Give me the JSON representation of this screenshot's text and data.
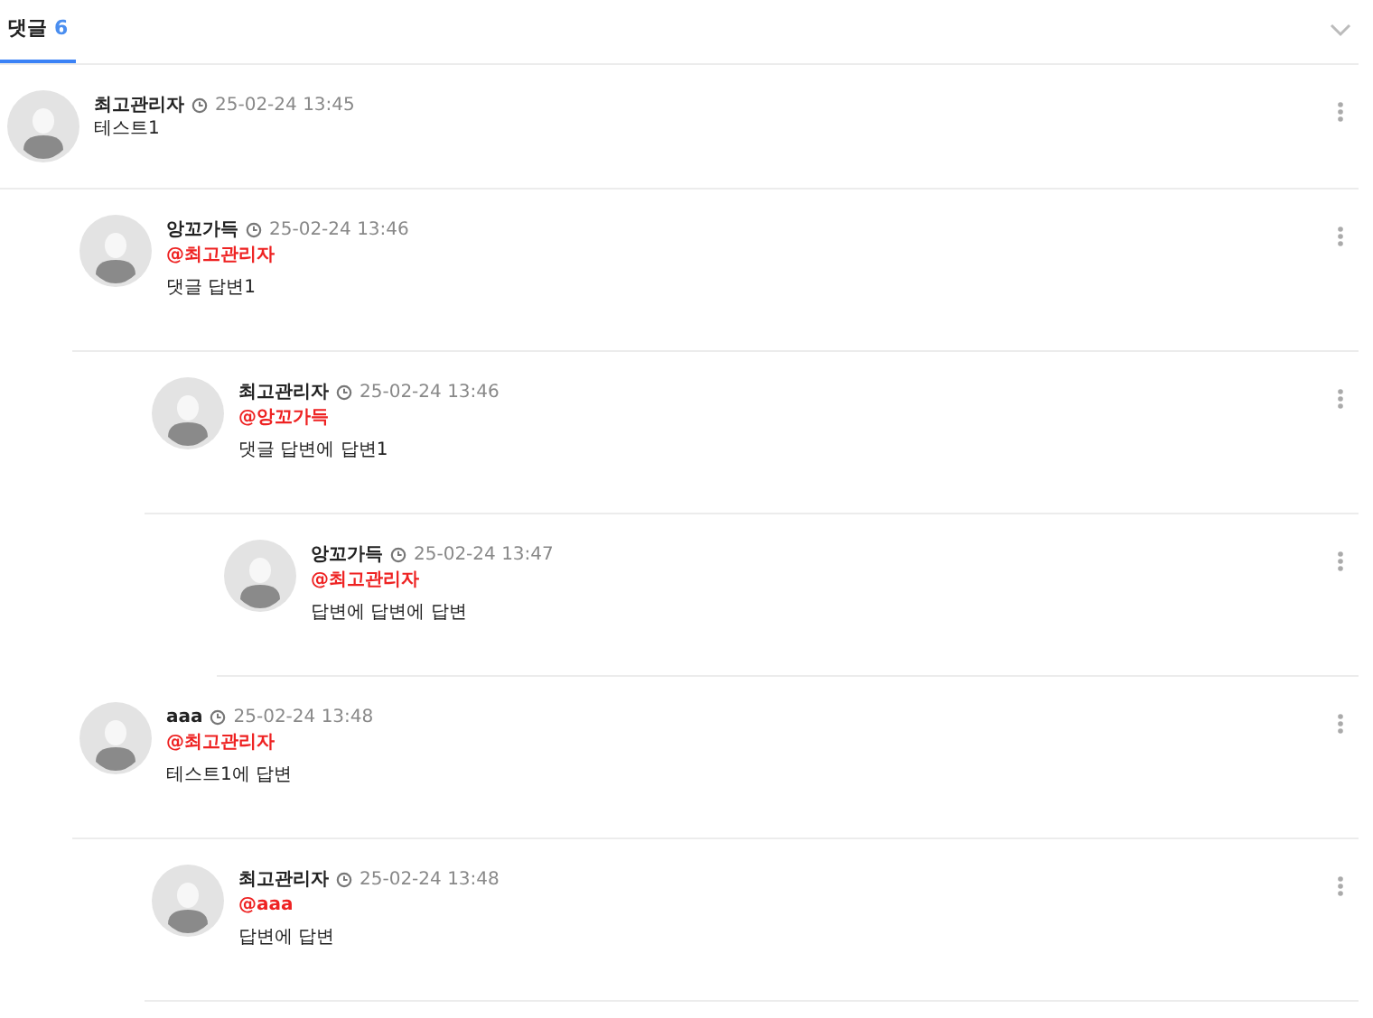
{
  "header": {
    "title": "댓글",
    "count": "6"
  },
  "comments": [
    {
      "author": "최고관리자",
      "time": "25-02-24 13:45",
      "text": "테스트1",
      "children": [
        {
          "author": "앙꼬가득",
          "time": "25-02-24 13:46",
          "mention": "@최고관리자",
          "text": "댓글 답변1",
          "children": [
            {
              "author": "최고관리자",
              "time": "25-02-24 13:46",
              "mention": "@앙꼬가득",
              "text": "댓글 답변에 답변1",
              "children": [
                {
                  "author": "앙꼬가득",
                  "time": "25-02-24 13:47",
                  "mention": "@최고관리자",
                  "text": "답변에 답변에 답변"
                }
              ]
            }
          ]
        },
        {
          "author": "aaa",
          "time": "25-02-24 13:48",
          "mention": "@최고관리자",
          "text": "테스트1에 답변",
          "children": [
            {
              "author": "최고관리자",
              "time": "25-02-24 13:48",
              "mention": "@aaa",
              "text": "답변에 답변"
            }
          ]
        }
      ]
    }
  ]
}
